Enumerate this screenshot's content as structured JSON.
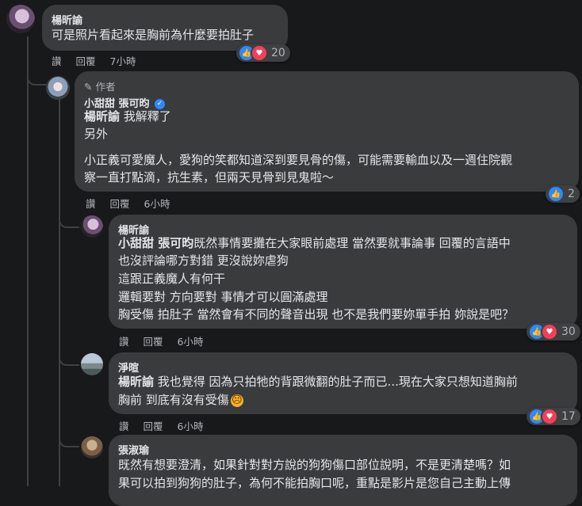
{
  "comments": [
    {
      "author": "楊昕諭",
      "lines": [
        "可是照片看起來是胸前為什麼要拍肚子"
      ],
      "actions": {
        "like": "讚",
        "reply": "回覆",
        "time": "7小時"
      },
      "reactions": {
        "count": "20"
      }
    },
    {
      "badge": "作者",
      "author": "小甜甜 張可昀",
      "mention": "楊昕諭",
      "line1_rest": " 我解釋了",
      "line2": "另外",
      "lines": [
        "小正義可愛魔人，愛狗的笑都知道深到要見骨的傷，可能需要輸血以及一週住院觀",
        "察一直打點滴，抗生素，但兩天見骨到見鬼啦～"
      ],
      "actions": {
        "like": "讚",
        "reply": "回覆",
        "time": "6小時"
      },
      "reactions": {
        "count": "2"
      }
    },
    {
      "author": "楊昕諭",
      "mention": "小甜甜 張可昀",
      "line1_rest": "既然事情要攤在大家眼前處理 當然要就事論事 回覆的言語中",
      "lines": [
        "也沒評論哪方對錯 更沒說妳虐狗",
        "這跟正義魔人有何干",
        "邏輯要對 方向要對 事情才可以圓滿處理",
        "胸受傷 拍肚子 當然會有不同的聲音出現 也不是我們要妳單手拍 妳說是吧？"
      ],
      "actions": {
        "like": "讚",
        "reply": "回覆",
        "time": "6小時"
      },
      "reactions": {
        "count": "30"
      }
    },
    {
      "author": "淨暄",
      "mention": "楊昕諭",
      "line1_rest": " 我也覺得 因為只拍牠的背跟微翻的肚子而已...現在大家只想知道胸前",
      "line2": "胸前 到底有沒有受傷",
      "actions": {
        "like": "讚",
        "reply": "回覆",
        "time": "6小時"
      },
      "reactions": {
        "count": "17"
      }
    },
    {
      "author": "張淑瑜",
      "lines": [
        "既然有想要澄清，如果針對對方說的狗狗傷口部位說明，不是更清楚嗎？如",
        "果可以拍到狗狗的肚子，為何不能拍胸口呢，重點是影片是您自己主動上傳"
      ]
    }
  ],
  "icons": {
    "like": "👍",
    "love": "♥",
    "pencil": "✎",
    "sad": "☹"
  },
  "colors": {
    "like": "#2d88ff",
    "love": "#f33e58",
    "verified": "#2d88ff",
    "sad": "#f7b125"
  }
}
